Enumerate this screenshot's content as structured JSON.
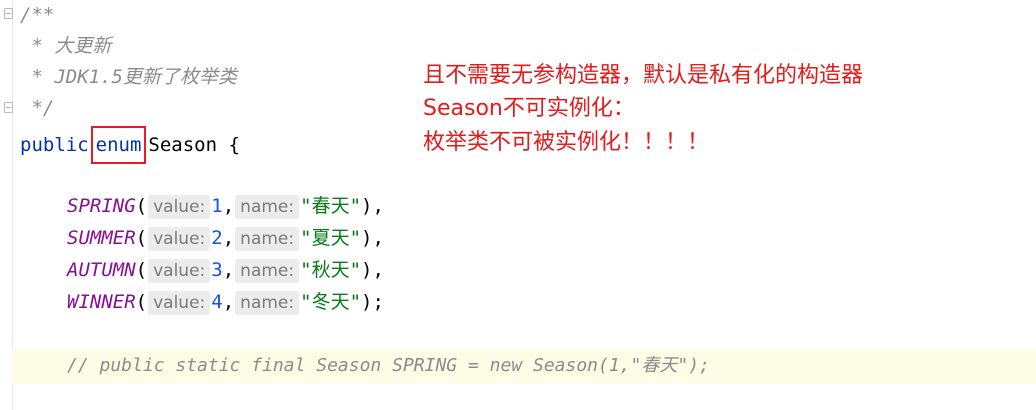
{
  "code": {
    "doc_open": "/**",
    "doc_line1": " * 大更新",
    "doc_line2": " * JDK1.5更新了枚举类",
    "doc_close": " */",
    "decl_kw": "public",
    "enum_kw": "enum",
    "class_name": "Season",
    "brace": "{",
    "hint_value": "value:",
    "hint_name": "name:",
    "constants": [
      {
        "name": "SPRING",
        "value": "1",
        "label": "\"春天\"",
        "end": "),"
      },
      {
        "name": "SUMMER",
        "value": "2",
        "label": "\"夏天\"",
        "end": "),"
      },
      {
        "name": "AUTUMN",
        "value": "3",
        "label": "\"秋天\"",
        "end": "),"
      },
      {
        "name": "WINNER",
        "value": "4",
        "label": "\"冬天\"",
        "end": ");"
      }
    ],
    "comment_line": "// public static final Season SPRING = new Season(1,\"春天\");"
  },
  "annotation": {
    "line1": "且不需要无参构造器，默认是私有化的构造器",
    "line2": "Season不可实例化：",
    "line3": "枚举类不可被实例化！！！！"
  },
  "colors": {
    "annotation": "#e61a1a",
    "enum_box": "#e02020",
    "keyword": "#0033b3",
    "constant": "#871094",
    "string": "#067d17",
    "number": "#1750eb",
    "comment": "#8c8c8c"
  }
}
